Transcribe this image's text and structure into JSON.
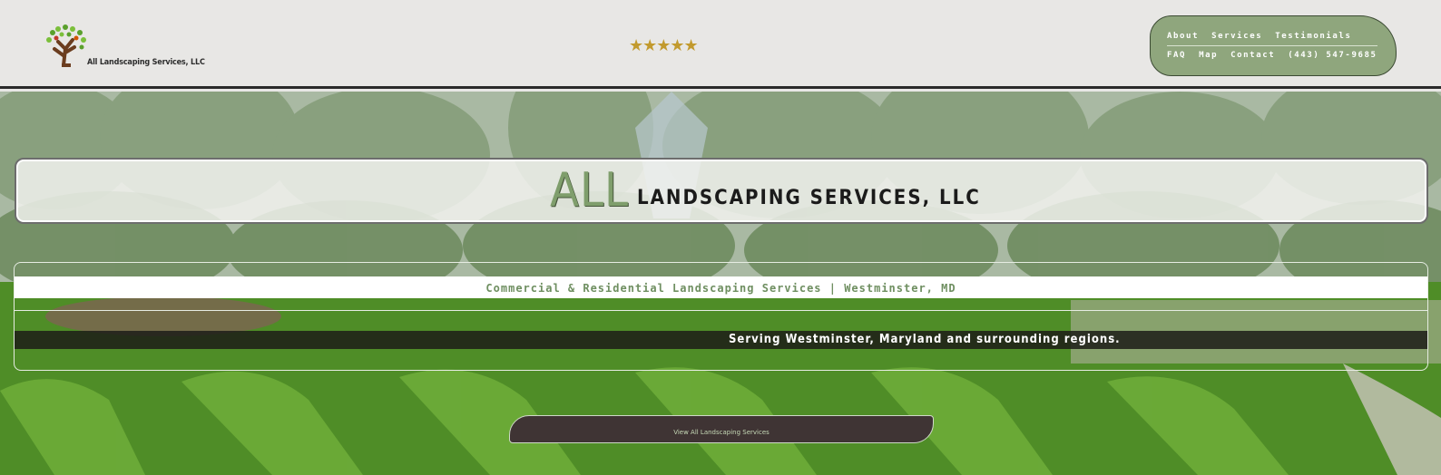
{
  "brand": {
    "logo_text": "All Landscaping Services, LLC",
    "rating_stars": "★★★★★"
  },
  "nav": {
    "row1": [
      "About",
      "Services",
      "Testimonials"
    ],
    "row2": [
      "FAQ",
      "Map",
      "Contact",
      "(443) 547-9685"
    ]
  },
  "hero": {
    "title_all": "ALL",
    "title_rest": "LANDSCAPING SERVICES, LLC",
    "tagline": "Commercial & Residential Landscaping Services | Westminster, MD",
    "serving": "Serving Westminster, Maryland and surrounding regions.",
    "cta_label": "View All Landscaping Services"
  },
  "colors": {
    "accent_green": "#8fa67d",
    "tagline_green": "#6f8f61",
    "star_gold": "#c29a2e",
    "cta_brown": "#3f3434"
  }
}
